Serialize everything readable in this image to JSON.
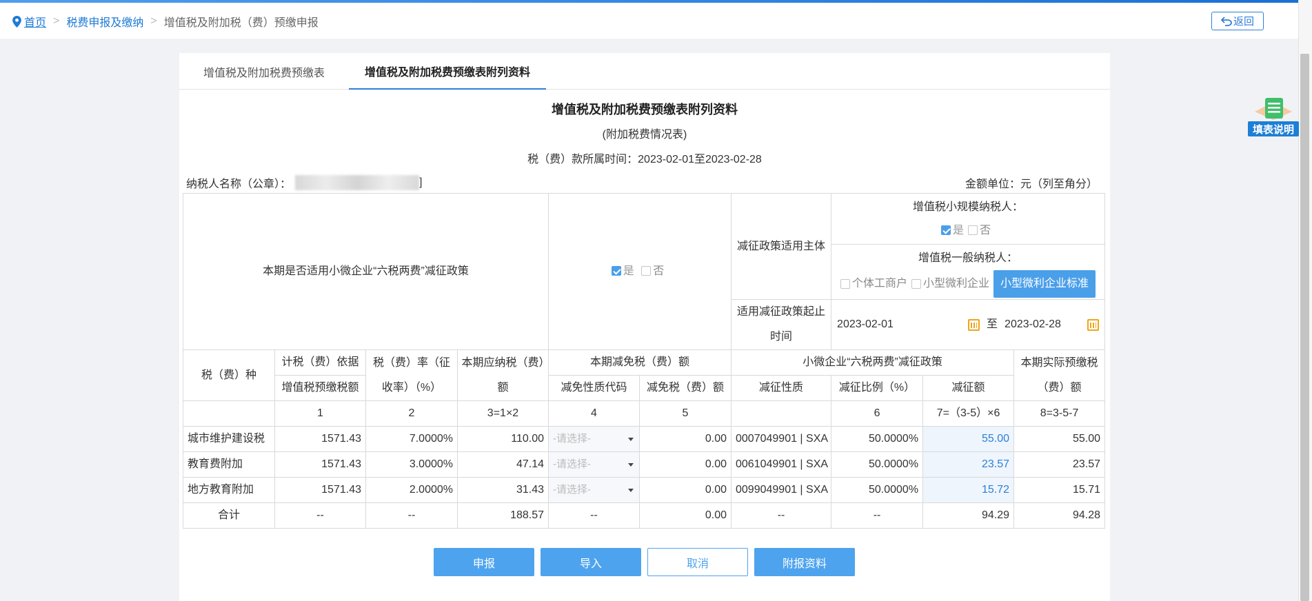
{
  "breadcrumb": {
    "home": "首页",
    "level2": "税费申报及缴纳",
    "current": "增值税及附加税（费）预缴申报"
  },
  "back_label": "返回",
  "help_label": "填表说明",
  "tabs": [
    {
      "label": "增值税及附加税费预缴表"
    },
    {
      "label": "增值税及附加税费预缴表附列资料"
    }
  ],
  "form": {
    "title": "增值税及附加税费预缴表附列资料",
    "subtitle": "(附加税费情况表)",
    "period": "税（费）款所属时间：2023-02-01至2023-02-28",
    "taxpayer_label": "纳税人名称（公章）：",
    "taxpayer_tail": "]",
    "unit": "金额单位：元（列至角分）"
  },
  "policy": {
    "question": "本期是否适用小微企业“六税两费”减征政策",
    "yes": "是",
    "no": "否",
    "subject_label": "减征政策适用主体",
    "small_scale_label": "增值税小规模纳税人：",
    "general_label": "增值税一般纳税人：",
    "individual": "个体工商户",
    "small_micro": "小型微利企业",
    "standard_button": "小型微利企业标准",
    "period_label": "适用减征政策起止时间",
    "start": "2023-02-01",
    "to": "至",
    "end": "2023-02-28"
  },
  "headers": {
    "tax_type": "税（费）种",
    "basis": "计税（费）依据",
    "basis_sub": "增值税预缴税额",
    "rate": "税（费）率（征收率）（%）",
    "payable": "本期应纳税（费）额",
    "relief": "本期减免税（费）额",
    "relief_code": "减免性质代码",
    "relief_amount": "减免税（费）额",
    "policy": "小微企业“六税两费”减征政策",
    "policy_nature": "减征性质",
    "policy_ratio": "减征比例（%）",
    "policy_amount": "减征额",
    "actual": "本期实际预缴税（费）额",
    "idx": [
      "1",
      "2",
      "3=1×2",
      "4",
      "5",
      "",
      "6",
      "7=（3-5）×6",
      "8=3-5-7"
    ]
  },
  "select_placeholder": "-请选择-",
  "rows": [
    {
      "name": "城市维护建设税",
      "basis": "1571.43",
      "rate": "7.0000%",
      "payable": "110.00",
      "relief_amount": "0.00",
      "nature": "0007049901 | SXA",
      "ratio": "50.0000%",
      "reduce": "55.00",
      "actual": "55.00"
    },
    {
      "name": "教育费附加",
      "basis": "1571.43",
      "rate": "3.0000%",
      "payable": "47.14",
      "relief_amount": "0.00",
      "nature": "0061049901 | SXA",
      "ratio": "50.0000%",
      "reduce": "23.57",
      "actual": "23.57"
    },
    {
      "name": "地方教育附加",
      "basis": "1571.43",
      "rate": "2.0000%",
      "payable": "31.43",
      "relief_amount": "0.00",
      "nature": "0099049901 | SXA",
      "ratio": "50.0000%",
      "reduce": "15.72",
      "actual": "15.71"
    }
  ],
  "total": {
    "name": "合计",
    "basis": "--",
    "rate": "--",
    "payable": "188.57",
    "code": "--",
    "relief_amount": "0.00",
    "nature": "--",
    "ratio": "--",
    "reduce": "94.29",
    "actual": "94.28"
  },
  "buttons": {
    "submit": "申报",
    "import": "导入",
    "cancel": "取消",
    "attach": "附报资料"
  }
}
